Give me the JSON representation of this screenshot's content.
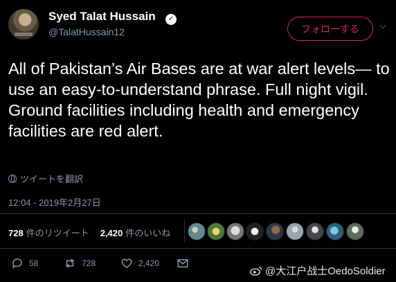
{
  "user": {
    "name": "Syed Talat Hussain",
    "handle": "@TalatHussain12"
  },
  "follow_label": "フォローする",
  "tweet": {
    "text": "All of Pakistan’s Air Bases are at war alert levels— to use an easy-to-understand phrase. Full night vigil. Ground facilities including health and emergency facilities are red alert."
  },
  "translate_label": "ツイートを翻訳",
  "timestamp": "12:04 - 2019年2月27日",
  "stats": {
    "retweets_count": "728",
    "retweets_label": "件のリツイート",
    "likes_count": "2,420",
    "likes_label": "件のいいね"
  },
  "actions": {
    "replies": "58",
    "retweets": "728",
    "likes": "2,420"
  },
  "watermark": "@大江户战士OedoSoldier",
  "colors": {
    "background": "#000000",
    "follow_accent": "#e0245e",
    "secondary_text": "#8899a6"
  }
}
